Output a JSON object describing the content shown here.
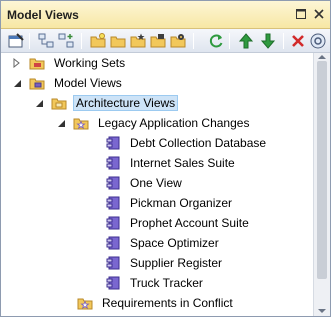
{
  "window": {
    "title": "Model Views",
    "pin_glyph": "▢",
    "close_glyph": "✕"
  },
  "toolbar": {
    "tools": [
      {
        "name": "view-properties-icon"
      },
      {
        "name": "add-view-icon"
      },
      {
        "name": "add-folder-icon"
      },
      {
        "name": "new-folder-icon"
      },
      {
        "name": "folder-open-icon"
      },
      {
        "name": "folder-star-icon"
      },
      {
        "name": "folder-link-icon"
      },
      {
        "name": "folder-settings-icon"
      },
      {
        "name": "refresh-icon"
      },
      {
        "name": "move-up-icon"
      },
      {
        "name": "move-down-icon"
      },
      {
        "name": "delete-icon"
      },
      {
        "name": "help-icon"
      }
    ]
  },
  "tree": {
    "working_sets": "Working Sets",
    "model_views": "Model Views",
    "architecture_views": "Architecture Views",
    "legacy_changes": "Legacy Application Changes",
    "items": [
      "Debt Collection Database",
      "Internet Sales Suite",
      "One View",
      "Pickman Organizer",
      "Prophet Account Suite",
      "Space Optimizer",
      "Supplier Register",
      "Truck Tracker"
    ],
    "requirements_conflict": "Requirements in Conflict"
  },
  "colors": {
    "title_bg": "#f7e7a4",
    "selection": "#cde3f7",
    "component_purple": "#5b4db0",
    "folder_gold": "#e6b84a"
  }
}
